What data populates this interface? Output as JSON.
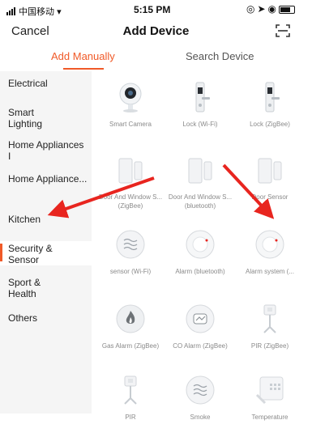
{
  "status_bar": {
    "carrier": "中国移动",
    "time": "5:15 PM"
  },
  "nav": {
    "cancel": "Cancel",
    "title": "Add Device",
    "scan_icon": "scan-icon"
  },
  "tabs": [
    {
      "label": "Add Manually",
      "active": true
    },
    {
      "label": "Search Device",
      "active": false
    }
  ],
  "sidebar": {
    "items": [
      {
        "label": "Electrical"
      },
      {
        "label": "Smart Lighting"
      },
      {
        "label": "Home Appliances I"
      },
      {
        "label": "Home Appliance..."
      },
      {
        "label": "Kitchen"
      },
      {
        "label": "Security & Sensor",
        "active": true
      },
      {
        "label": "Sport & Health"
      },
      {
        "label": "Others"
      }
    ]
  },
  "devices": [
    {
      "label": "Smart Camera",
      "icon": "camera-icon"
    },
    {
      "label": "Lock (Wi-Fi)",
      "icon": "door-lock-icon"
    },
    {
      "label": "Lock (ZigBee)",
      "icon": "door-lock-icon"
    },
    {
      "label": "Door And Window S... (ZigBee)",
      "icon": "door-sensor-icon"
    },
    {
      "label": "Door And Window S... (bluetooth)",
      "icon": "door-sensor-icon"
    },
    {
      "label": "Door Sensor",
      "icon": "door-sensor-icon"
    },
    {
      "label": "sensor (Wi-Fi)",
      "icon": "wave-sensor-icon"
    },
    {
      "label": "Alarm (bluetooth)",
      "icon": "smoke-alarm-icon"
    },
    {
      "label": "Alarm system (...",
      "icon": "smoke-alarm-icon"
    },
    {
      "label": "Gas Alarm (ZigBee)",
      "icon": "flame-icon"
    },
    {
      "label": "CO Alarm (ZigBee)",
      "icon": "co-alarm-icon"
    },
    {
      "label": "PIR (ZigBee)",
      "icon": "pir-sensor-icon"
    },
    {
      "label": "PIR",
      "icon": "pir-sensor-icon"
    },
    {
      "label": "Smoke",
      "icon": "wave-sensor-icon"
    },
    {
      "label": "Temperature",
      "icon": "temperature-sensor-icon"
    }
  ],
  "colors": {
    "accent": "#f05a28",
    "arrow": "#e8251f",
    "sidebar_bg": "#f5f5f5",
    "label_gray": "#8a8a8a"
  }
}
